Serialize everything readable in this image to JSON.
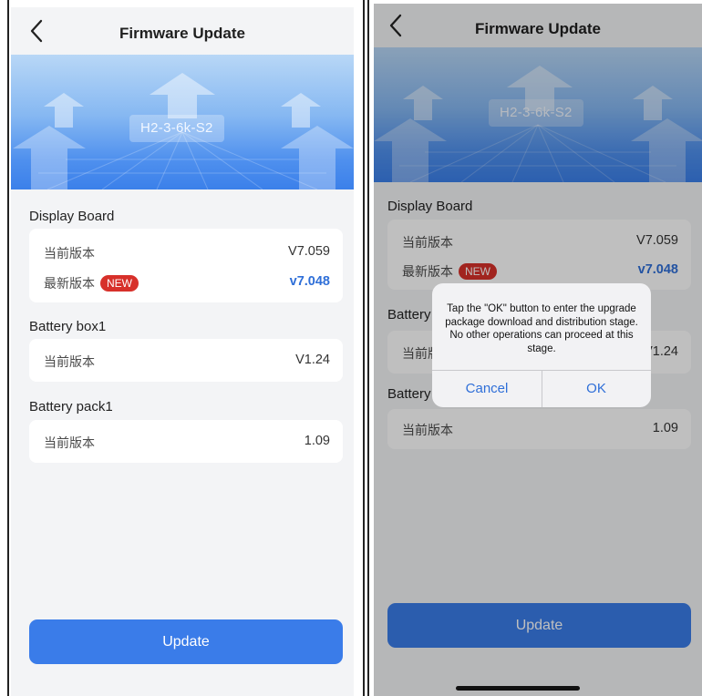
{
  "colors": {
    "accent": "#3a7ce9",
    "link": "#2f6fd8",
    "badge": "#d7302a",
    "background": "#f3f4f6"
  },
  "icons": {
    "back": "chevron-left-icon"
  },
  "screens": [
    {
      "nav": {
        "title": "Firmware Update"
      },
      "banner": {
        "model": "H2-3-6k-S2"
      },
      "sections": [
        {
          "title": "Display Board",
          "rows": [
            {
              "label": "当前版本",
              "value": "V7.059"
            },
            {
              "label": "最新版本",
              "badge": "NEW",
              "value": "v7.048"
            }
          ]
        },
        {
          "title": "Battery box1",
          "rows": [
            {
              "label": "当前版本",
              "value": "V1.24"
            }
          ]
        },
        {
          "title": "Battery pack1",
          "rows": [
            {
              "label": "当前版本",
              "value": "1.09"
            }
          ]
        }
      ],
      "update_label": "Update"
    },
    {
      "nav": {
        "title": "Firmware Update"
      },
      "banner": {
        "model": "H2-3-6k-S2"
      },
      "sections": [
        {
          "title": "Display Board",
          "rows": [
            {
              "label": "当前版本",
              "value": "V7.059"
            },
            {
              "label": "最新版本",
              "badge": "NEW",
              "value": "v7.048"
            }
          ]
        },
        {
          "title": "Battery",
          "rows": [
            {
              "label": "当前版本",
              "value": "V1.24"
            }
          ]
        },
        {
          "title": "Battery",
          "rows": [
            {
              "label": "当前版本",
              "value": "1.09"
            }
          ]
        }
      ],
      "update_label": "Update",
      "dialog": {
        "message": "Tap the \"OK\" button to enter the upgrade package download and distribution stage. No other operations can proceed at this stage.",
        "cancel_label": "Cancel",
        "ok_label": "OK"
      }
    }
  ]
}
